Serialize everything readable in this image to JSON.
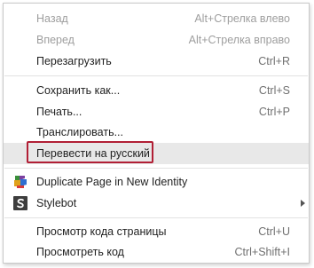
{
  "menu": {
    "back": {
      "label": "Назад",
      "shortcut": "Alt+Стрелка влево"
    },
    "forward": {
      "label": "Вперед",
      "shortcut": "Alt+Стрелка вправо"
    },
    "reload": {
      "label": "Перезагрузить",
      "shortcut": "Ctrl+R"
    },
    "save_as": {
      "label": "Сохранить как...",
      "shortcut": "Ctrl+S"
    },
    "print": {
      "label": "Печать...",
      "shortcut": "Ctrl+P"
    },
    "cast": {
      "label": "Транслировать..."
    },
    "translate": {
      "label": "Перевести на русский"
    },
    "duplicate_page": {
      "label": "Duplicate Page in New Identity",
      "icon": "duplicate-page-extension-icon"
    },
    "stylebot": {
      "label": "Stylebot",
      "icon": "stylebot-extension-icon"
    },
    "view_source": {
      "label": "Просмотр кода страницы",
      "shortcut": "Ctrl+U"
    },
    "inspect": {
      "label": "Просмотреть код",
      "shortcut": "Ctrl+Shift+I"
    }
  },
  "colors": {
    "highlight_border": "#b11f35",
    "disabled_text": "#9e9e9e",
    "hover_background": "#e8e8e8"
  }
}
